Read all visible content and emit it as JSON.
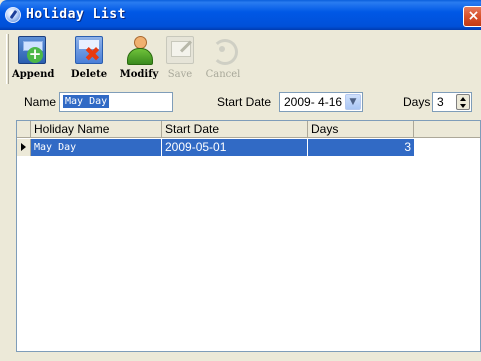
{
  "window": {
    "title": "Holiday List",
    "close_glyph": "×"
  },
  "toolbar": {
    "buttons": [
      {
        "label": "Append",
        "icon": "append-icon",
        "enabled": true
      },
      {
        "label": "Delete",
        "icon": "delete-icon",
        "enabled": true
      },
      {
        "label": "Modify",
        "icon": "modify-icon",
        "enabled": true
      },
      {
        "label": "Save",
        "icon": "save-icon",
        "enabled": false
      },
      {
        "label": "Cancel",
        "icon": "cancel-icon",
        "enabled": false
      }
    ]
  },
  "filters": {
    "name_label": "Name",
    "name_value": "May Day",
    "start_date_label": "Start Date",
    "start_date_value": "2009- 4-16",
    "days_label": "Days",
    "days_value": "3"
  },
  "grid": {
    "columns": [
      "Holiday Name",
      "Start Date",
      "Days"
    ],
    "rows": [
      {
        "name": "May Day",
        "start_date": "2009-05-01",
        "days": "3",
        "selected": true
      }
    ]
  },
  "colors": {
    "selection": "#316ac5",
    "titlebar": "#0058e6",
    "face": "#ece9d8"
  }
}
